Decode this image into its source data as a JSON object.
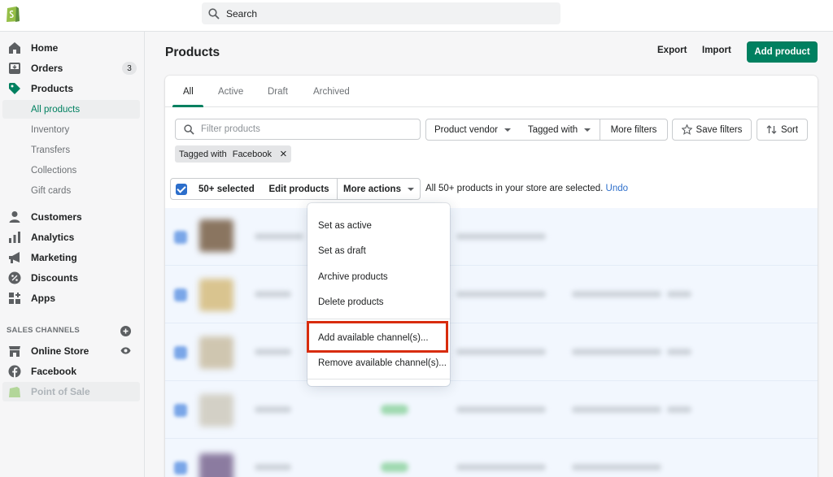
{
  "topbar": {
    "search_placeholder": "Search"
  },
  "sidebar": {
    "items": [
      {
        "label": "Home",
        "icon": "home-icon"
      },
      {
        "label": "Orders",
        "icon": "orders-icon",
        "badge": "3"
      },
      {
        "label": "Products",
        "icon": "tag-icon"
      }
    ],
    "product_subitems": [
      "All products",
      "Inventory",
      "Transfers",
      "Collections",
      "Gift cards"
    ],
    "items2": [
      {
        "label": "Customers",
        "icon": "person-icon"
      },
      {
        "label": "Analytics",
        "icon": "bar-chart-icon"
      },
      {
        "label": "Marketing",
        "icon": "megaphone-icon"
      },
      {
        "label": "Discounts",
        "icon": "discount-icon"
      },
      {
        "label": "Apps",
        "icon": "apps-icon"
      }
    ],
    "sales_channels_title": "SALES CHANNELS",
    "channels": [
      {
        "label": "Online Store",
        "icon": "store-icon"
      },
      {
        "label": "Facebook",
        "icon": "facebook-icon"
      },
      {
        "label": "Point of Sale",
        "icon": "shopify-bag-icon"
      }
    ]
  },
  "header": {
    "title": "Products",
    "export": "Export",
    "import": "Import",
    "add_product": "Add product"
  },
  "tabs": [
    "All",
    "Active",
    "Draft",
    "Archived"
  ],
  "filters": {
    "placeholder": "Filter products",
    "product_vendor": "Product vendor",
    "tagged_with": "Tagged with",
    "more_filters": "More filters",
    "save_filters": "Save filters",
    "sort": "Sort"
  },
  "applied_tag": {
    "prefix": "Tagged with",
    "value": "Facebook"
  },
  "bulk": {
    "selected": "50+ selected",
    "edit_products": "Edit products",
    "more_actions": "More actions",
    "info": "All 50+ products in your store are selected.",
    "undo": "Undo"
  },
  "more_actions_menu": [
    "Set as active",
    "Set as draft",
    "Archive products",
    "Delete products",
    "Add available channel(s)...",
    "Remove available channel(s)..."
  ],
  "colors": {
    "accent": "#008060",
    "highlight": "#d82c0d",
    "link": "#2c6ecb"
  }
}
